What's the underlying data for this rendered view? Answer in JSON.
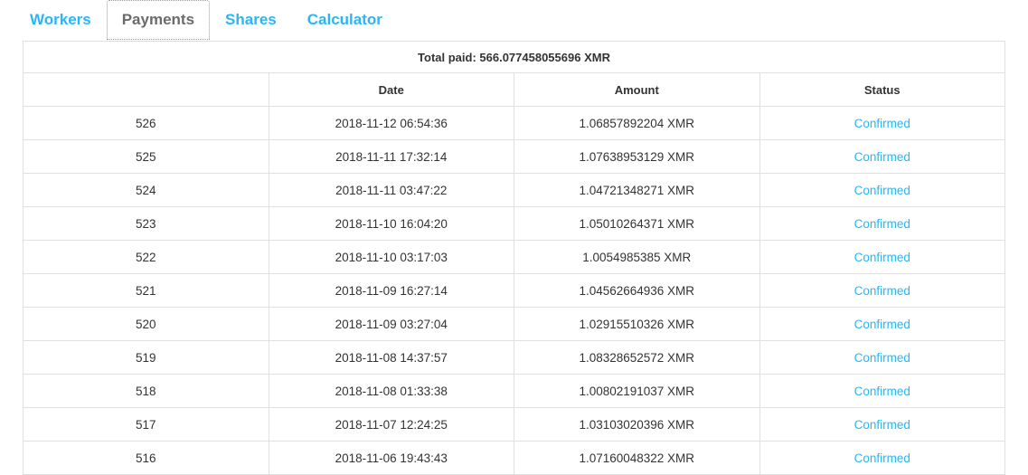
{
  "tabs": [
    {
      "label": "Workers",
      "active": false
    },
    {
      "label": "Payments",
      "active": true
    },
    {
      "label": "Shares",
      "active": false
    },
    {
      "label": "Calculator",
      "active": false
    }
  ],
  "summary": {
    "total_paid_text": "Total paid: 566.077458055696 XMR"
  },
  "table": {
    "headers": {
      "index": "",
      "date": "Date",
      "amount": "Amount",
      "status": "Status"
    },
    "rows": [
      {
        "index": "526",
        "date": "2018-11-12 06:54:36",
        "amount": "1.06857892204 XMR",
        "status": "Confirmed"
      },
      {
        "index": "525",
        "date": "2018-11-11 17:32:14",
        "amount": "1.07638953129 XMR",
        "status": "Confirmed"
      },
      {
        "index": "524",
        "date": "2018-11-11 03:47:22",
        "amount": "1.04721348271 XMR",
        "status": "Confirmed"
      },
      {
        "index": "523",
        "date": "2018-11-10 16:04:20",
        "amount": "1.05010264371 XMR",
        "status": "Confirmed"
      },
      {
        "index": "522",
        "date": "2018-11-10 03:17:03",
        "amount": "1.0054985385 XMR",
        "status": "Confirmed"
      },
      {
        "index": "521",
        "date": "2018-11-09 16:27:14",
        "amount": "1.04562664936 XMR",
        "status": "Confirmed"
      },
      {
        "index": "520",
        "date": "2018-11-09 03:27:04",
        "amount": "1.02915510326 XMR",
        "status": "Confirmed"
      },
      {
        "index": "519",
        "date": "2018-11-08 14:37:57",
        "amount": "1.08328652572 XMR",
        "status": "Confirmed"
      },
      {
        "index": "518",
        "date": "2018-11-08 01:33:38",
        "amount": "1.00802191037 XMR",
        "status": "Confirmed"
      },
      {
        "index": "517",
        "date": "2018-11-07 12:24:25",
        "amount": "1.03103020396 XMR",
        "status": "Confirmed"
      },
      {
        "index": "516",
        "date": "2018-11-06 19:43:43",
        "amount": "1.07160048322 XMR",
        "status": "Confirmed"
      }
    ]
  },
  "colors": {
    "link": "#29b6f6",
    "active_tab_text": "#6b6b6b",
    "border": "#e0e0e0",
    "text": "#333333"
  }
}
